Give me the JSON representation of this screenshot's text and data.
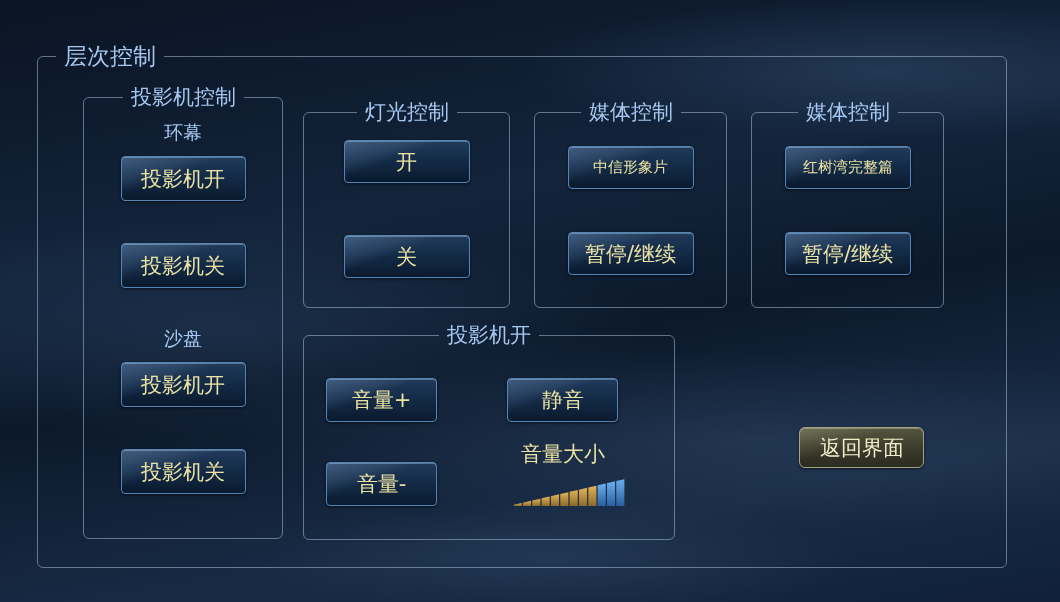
{
  "panel": {
    "title": "层次控制"
  },
  "projector_control": {
    "title": "投影机控制",
    "sections": [
      {
        "label": "环幕",
        "buttons": [
          "投影机开",
          "投影机关"
        ]
      },
      {
        "label": "沙盘",
        "buttons": [
          "投影机开",
          "投影机关"
        ]
      }
    ]
  },
  "groups": [
    {
      "title": "灯光控制",
      "buttons": [
        {
          "label": "开",
          "kind": "action"
        },
        {
          "label": "关",
          "kind": "action"
        }
      ]
    },
    {
      "title": "媒体控制",
      "buttons": [
        {
          "label": "中信形象片",
          "kind": "clip"
        },
        {
          "label": "暂停/继续",
          "kind": "action"
        }
      ]
    },
    {
      "title": "媒体控制",
      "buttons": [
        {
          "label": "红树湾完整篇",
          "kind": "clip"
        },
        {
          "label": "暂停/继续",
          "kind": "action"
        }
      ]
    }
  ],
  "volume_panel": {
    "title": "投影机开",
    "buttons": [
      "音量+",
      "静音",
      "音量-"
    ],
    "meter": {
      "label": "音量大小",
      "level": 0.75
    }
  },
  "return_button": {
    "label": "返回界面"
  }
}
